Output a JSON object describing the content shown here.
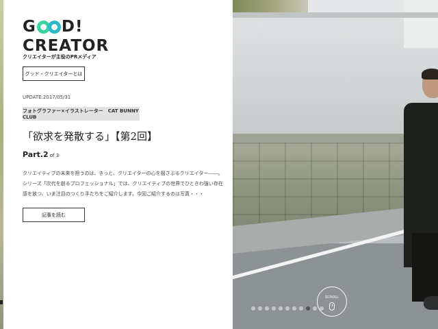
{
  "brand": {
    "logo_g": "G",
    "logo_d": "D!",
    "logo_line2": "CREATOR",
    "tagline": "クリエイターが主役のPRメディア",
    "accent_colors": [
      "#37d3a1",
      "#2bb8c8"
    ]
  },
  "about_button": {
    "label": "グッド・クリエイターとは"
  },
  "article": {
    "update": "UPDATE:2017/05/31",
    "category": "フォトグラファー×イラストレーター　CAT BUNNY CLUB",
    "headline": "「欲求を発散する」【第2回】",
    "part_label": "Part.2",
    "part_of": "of 3",
    "excerpt": "クリエイティブの未来を担うのは、きっと、クリエイターの心を揺さぶるクリエイター――。シリーズ「次代を創るプロフェッショナル」では、クリエイティブの世界でひときわ強い存在感を放つ、いま注目のつくり手たちをご紹介します。今回ご紹介するのは写真・・・",
    "read_button": "記事を読む"
  },
  "scroll": {
    "label": "SCROLL"
  },
  "pagination": {
    "total": 11,
    "active_index": 8
  }
}
